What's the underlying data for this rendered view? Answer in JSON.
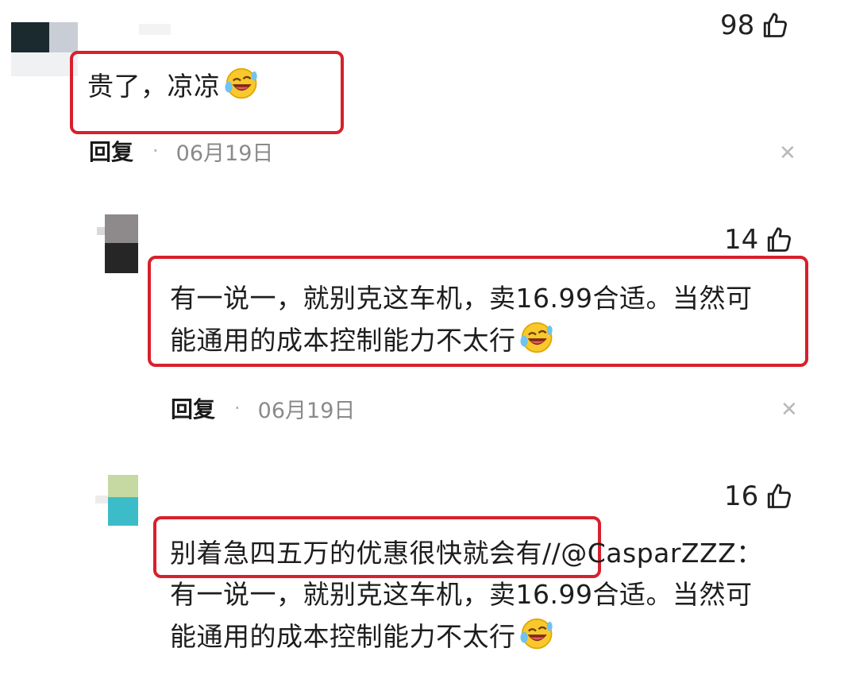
{
  "comments": [
    {
      "likes": "98",
      "text": "贵了，凉凉",
      "reply_label": "回复",
      "date": "06月19日"
    },
    {
      "likes": "14",
      "line1": "有一说一，就别克这车机，卖16.99合适。当然可",
      "line2": "能通用的成本控制能力不太行",
      "reply_label": "回复",
      "date": "06月19日"
    },
    {
      "likes": "16",
      "line1_hl": "别着急四五万的优惠很快就会有",
      "line1_rest": "//@CasparZZZ：",
      "line2": "有一说一，就别克这车机，卖16.99合适。当然可",
      "line3": "能通用的成本控制能力不太行"
    }
  ],
  "icons": {
    "like": "thumbs-up-icon",
    "emoji": "laughing-tears-emoji-icon",
    "close": "close-icon"
  },
  "colors": {
    "highlight_box": "#d8202c",
    "meta_text": "#8a8a8a"
  }
}
